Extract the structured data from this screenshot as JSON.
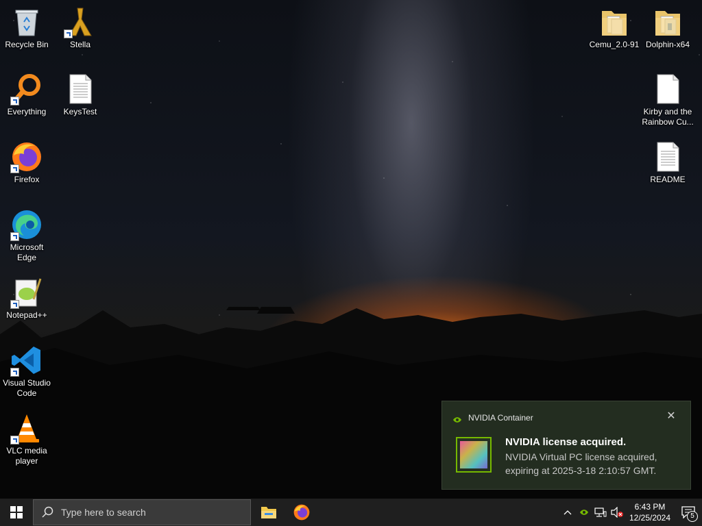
{
  "desktop": {
    "left_icons": [
      {
        "label": "Recycle Bin",
        "icon": "recycle-bin-icon",
        "shortcut": false
      },
      {
        "label": "Everything",
        "icon": "everything-search-icon",
        "shortcut": true
      },
      {
        "label": "Firefox",
        "icon": "firefox-icon",
        "shortcut": true
      },
      {
        "label": "Microsoft Edge",
        "icon": "edge-icon",
        "shortcut": true
      },
      {
        "label": "Notepad++",
        "icon": "notepad-plus-plus-icon",
        "shortcut": true
      },
      {
        "label": "Visual Studio Code",
        "icon": "vscode-icon",
        "shortcut": true
      },
      {
        "label": "VLC media player",
        "icon": "vlc-icon",
        "shortcut": true
      }
    ],
    "second_column_icons": [
      {
        "label": "Stella",
        "icon": "stella-icon",
        "shortcut": true
      },
      {
        "label": "KeysTest",
        "icon": "text-file-icon",
        "shortcut": false
      }
    ],
    "right_icons": [
      {
        "label": "Cemu_2.0-91",
        "icon": "folder-icon"
      },
      {
        "label": "Dolphin-x64",
        "icon": "folder-icon"
      },
      {
        "label": "Kirby and the Rainbow Cu...",
        "icon": "blank-file-icon"
      },
      {
        "label": "README",
        "icon": "text-file-icon"
      }
    ]
  },
  "taskbar": {
    "search_placeholder": "Type here to search",
    "pinned": [
      "file-explorer-icon",
      "firefox-icon"
    ],
    "clock_time": "6:43 PM",
    "clock_date": "12/25/2024",
    "notification_count": "5"
  },
  "toast": {
    "app_name": "NVIDIA Container",
    "title": "NVIDIA license acquired.",
    "body": "NVIDIA Virtual PC license acquired, expiring at 2025-3-18 2:10:57 GMT.",
    "accent_color": "#76b900"
  }
}
